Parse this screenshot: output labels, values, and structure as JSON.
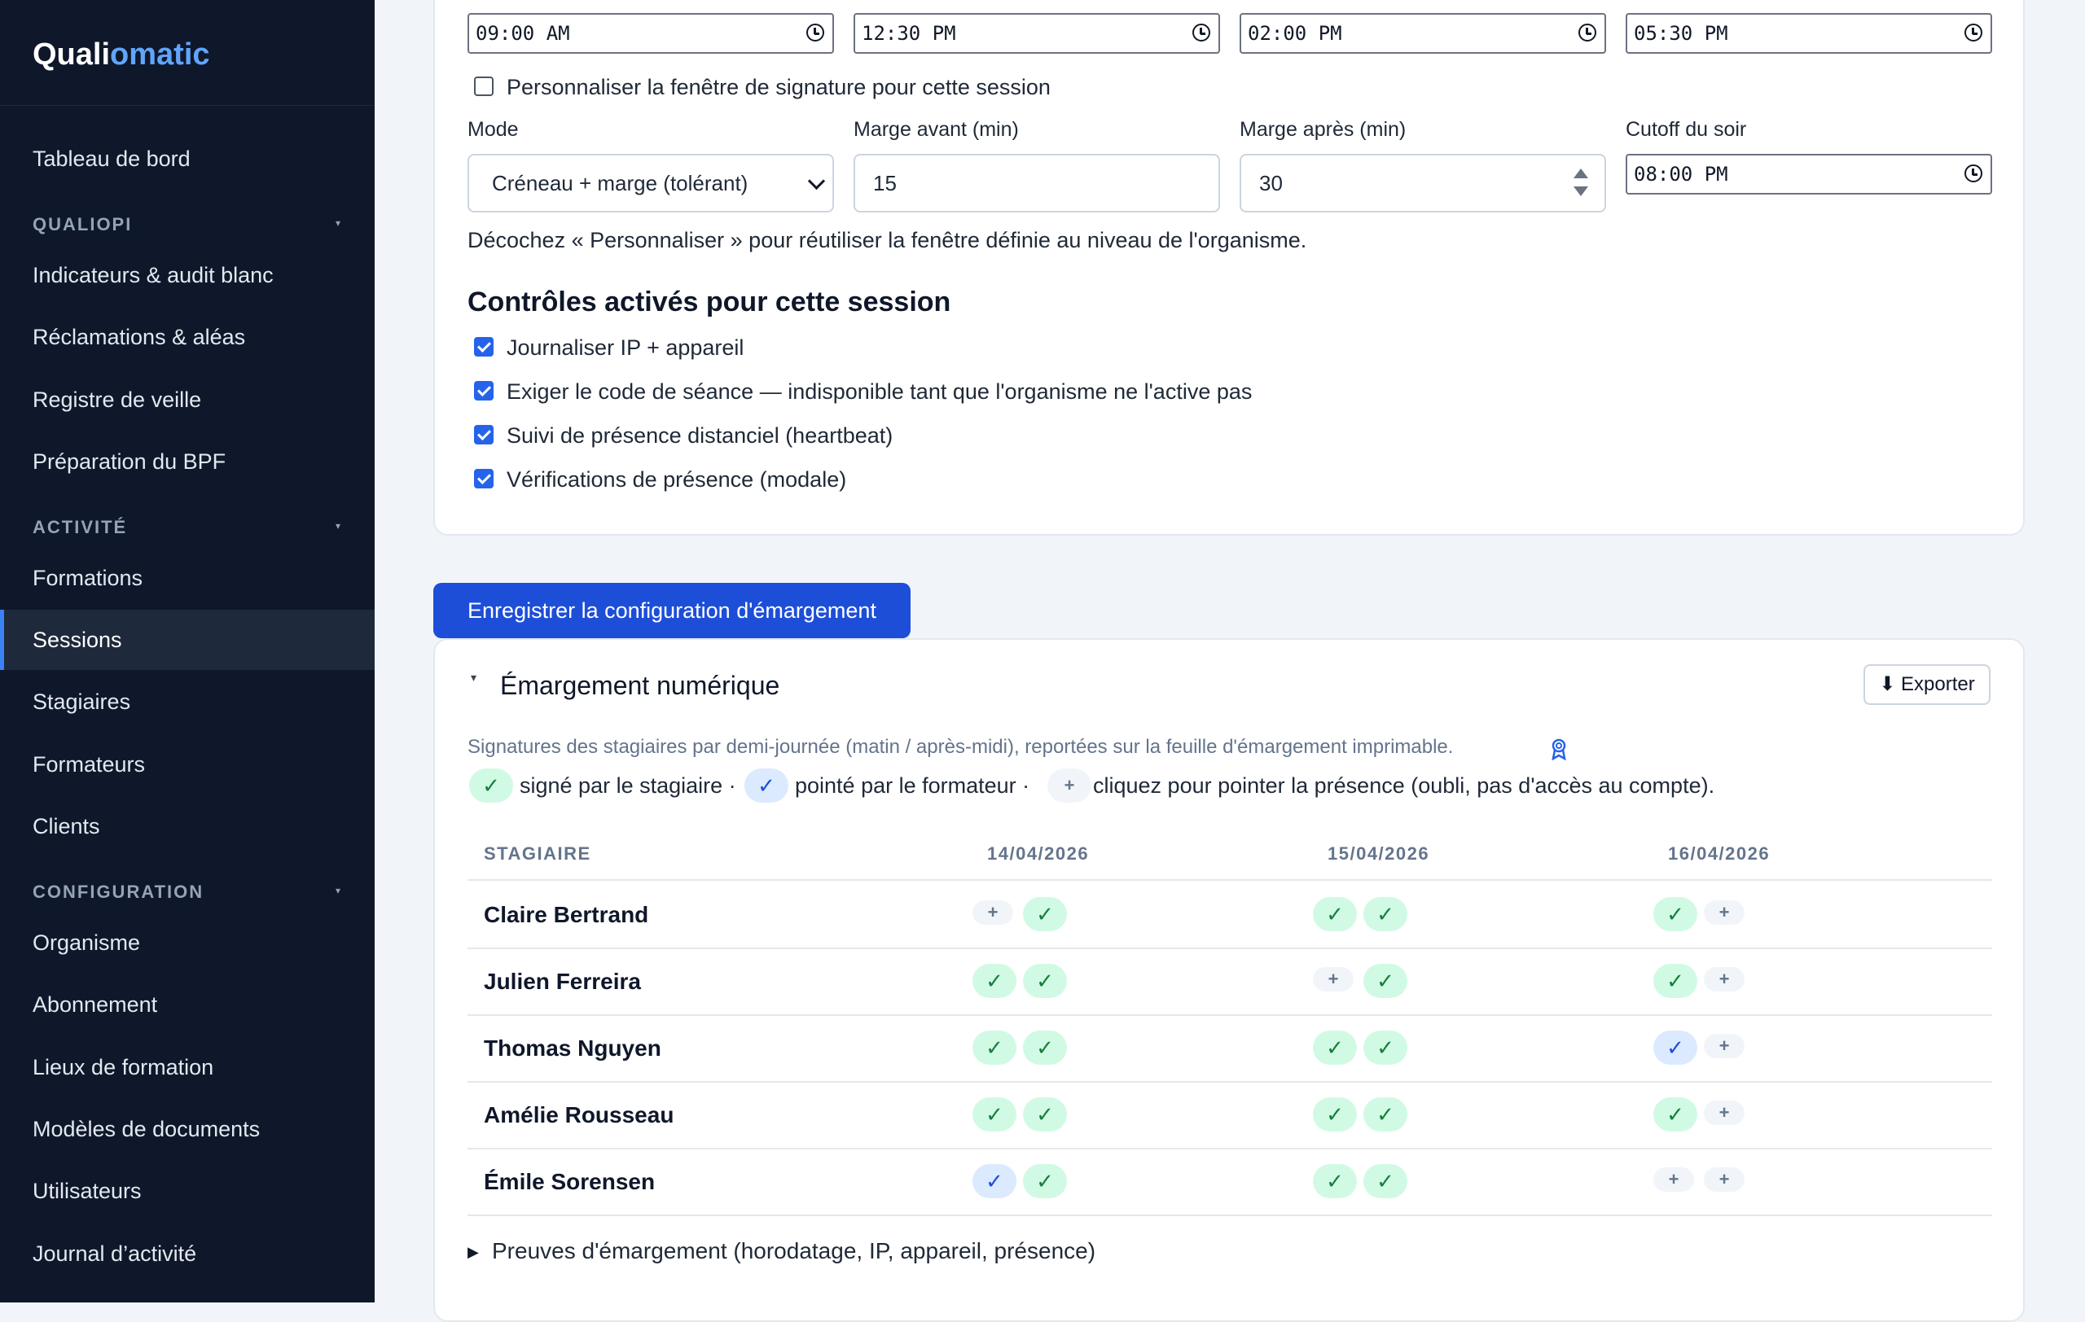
{
  "brand": {
    "prefix": "Quali",
    "suffix": "omatic"
  },
  "sidebar": {
    "dashboard": "Tableau de bord",
    "sections": [
      {
        "title": "QUALIOPI",
        "items": [
          "Indicateurs & audit blanc",
          "Réclamations & aléas",
          "Registre de veille",
          "Préparation du BPF"
        ]
      },
      {
        "title": "ACTIVITÉ",
        "items": [
          "Formations",
          "Sessions",
          "Stagiaires",
          "Formateurs",
          "Clients"
        ]
      },
      {
        "title": "CONFIGURATION",
        "items": [
          "Organisme",
          "Abonnement",
          "Lieux de formation",
          "Modèles de documents",
          "Utilisateurs",
          "Journal d’activité"
        ]
      }
    ],
    "active": "Sessions"
  },
  "signature": {
    "times": [
      "09:00 AM",
      "12:30 PM",
      "02:00 PM",
      "05:30 PM"
    ],
    "customize_label": "Personnaliser la fenêtre de signature pour cette session",
    "customize_checked": false,
    "mode_label": "Mode",
    "mode_value": "Créneau + marge (tolérant)",
    "margin_before_label": "Marge avant (min)",
    "margin_before_value": "15",
    "margin_after_label": "Marge après (min)",
    "margin_after_value": "30",
    "cutoff_label": "Cutoff du soir",
    "cutoff_value": "08:00 PM",
    "hint": "Décochez « Personnaliser » pour réutiliser la fenêtre définie au niveau de l'organisme."
  },
  "controls": {
    "title": "Contrôles activés pour cette session",
    "items": [
      {
        "label": "Journaliser IP + appareil",
        "checked": true
      },
      {
        "label": "Exiger le code de séance — indisponible tant que l'organisme ne l'active pas",
        "checked": true
      },
      {
        "label": "Suivi de présence distanciel (heartbeat)",
        "checked": true
      },
      {
        "label": "Vérifications de présence (modale)",
        "checked": true
      }
    ]
  },
  "save_button": "Enregistrer la configuration d'émargement",
  "attendance": {
    "title": "Émargement numérique",
    "export_label": "⬇ Exporter",
    "description": "Signatures des stagiaires par demi-journée (matin / après-midi), reportées sur la feuille d'émargement imprimable.",
    "legend": {
      "signed": "signé par le stagiaire ·",
      "checked": "pointé par le formateur ·",
      "click": "cliquez pour pointer la présence (oubli, pas d'accès au compte)."
    },
    "columns": [
      "STAGIAIRE",
      "14/04/2026",
      "15/04/2026",
      "16/04/2026"
    ],
    "rows": [
      {
        "name": "Claire Bertrand",
        "marks": [
          "empty",
          "signed",
          "signed",
          "signed",
          "signed",
          "empty"
        ]
      },
      {
        "name": "Julien Ferreira",
        "marks": [
          "signed",
          "signed",
          "empty",
          "signed",
          "signed",
          "empty"
        ]
      },
      {
        "name": "Thomas Nguyen",
        "marks": [
          "signed",
          "signed",
          "signed",
          "signed",
          "trainer",
          "empty"
        ]
      },
      {
        "name": "Amélie Rousseau",
        "marks": [
          "signed",
          "signed",
          "signed",
          "signed",
          "signed",
          "empty"
        ]
      },
      {
        "name": "Émile Sorensen",
        "marks": [
          "trainer",
          "signed",
          "signed",
          "signed",
          "empty",
          "empty"
        ]
      }
    ],
    "proofs_label": "Preuves d'émargement (horodatage, IP, appareil, présence)"
  },
  "colors": {
    "sidebar_bg": "#0f172a",
    "primary": "#1d4ed8",
    "signed": "#15803d",
    "trainer": "#1d4ed8"
  },
  "icons": {
    "signed": "✓",
    "trainer": "✓",
    "empty": "+",
    "caret": "▾",
    "disclosure": "▶"
  }
}
